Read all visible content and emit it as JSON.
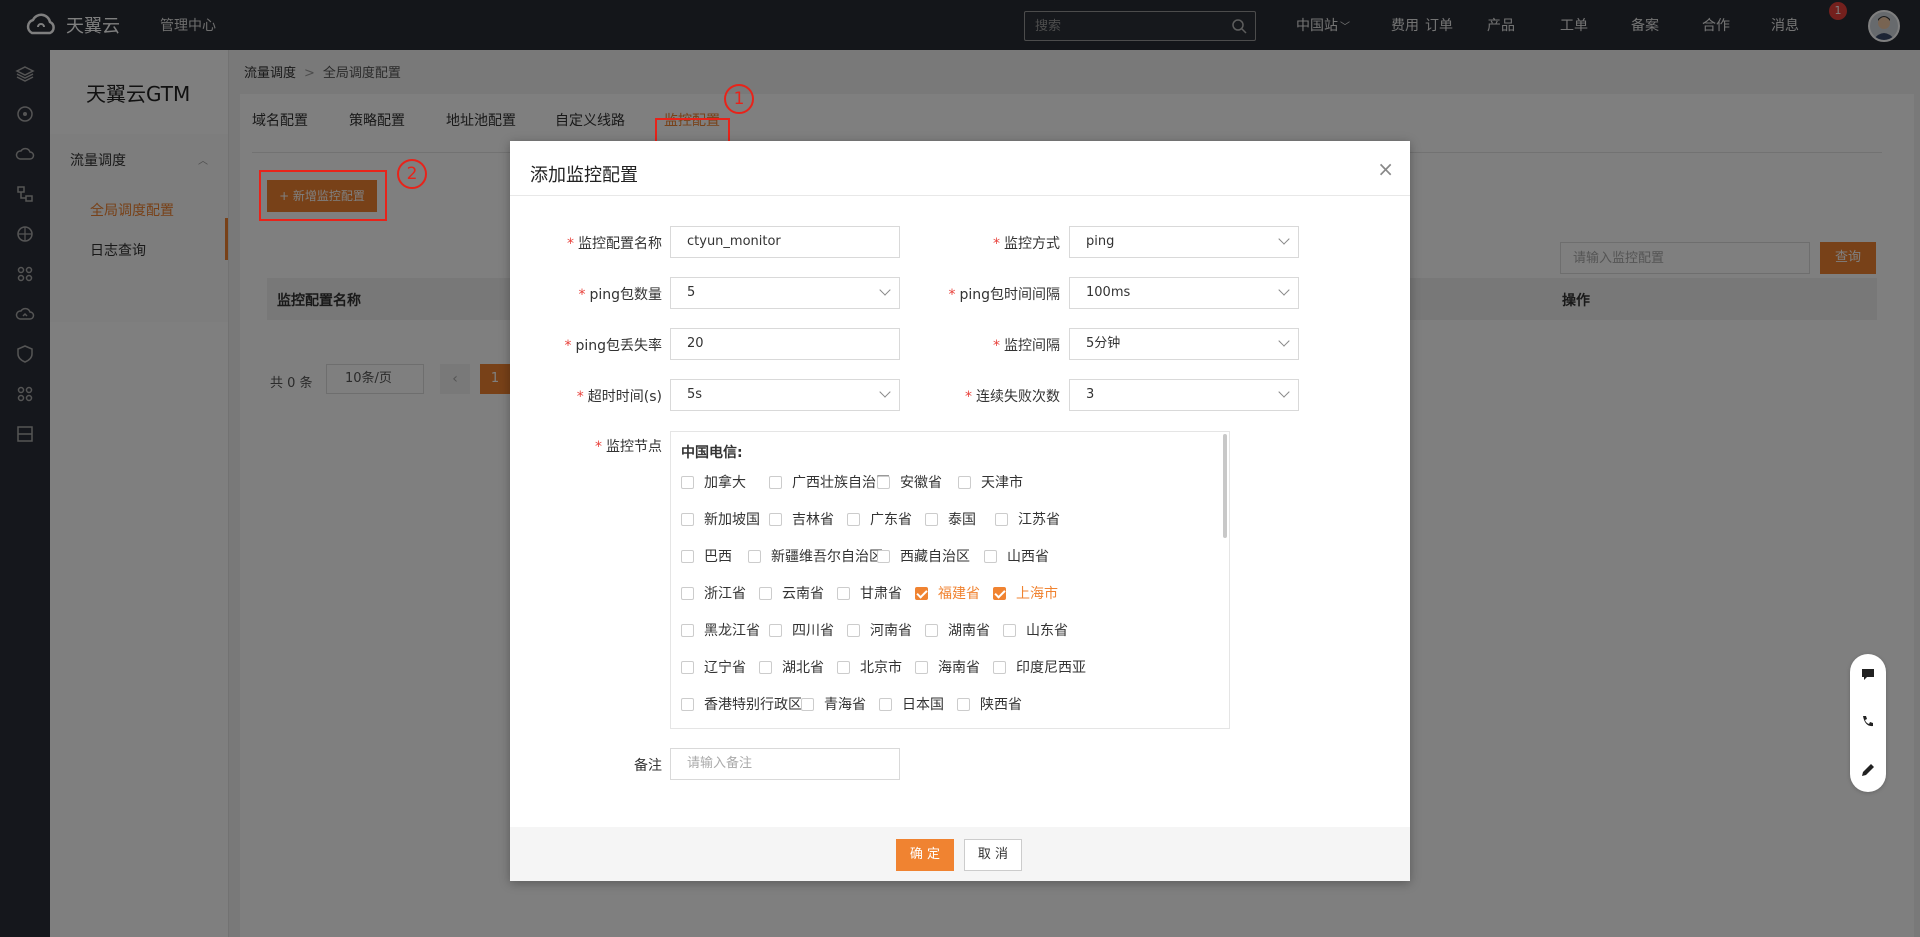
{
  "topbar": {
    "brand": "天翼云",
    "mgmt": "管理中心",
    "search_placeholder": "搜索",
    "nav": [
      "中国站",
      "费用",
      "订单",
      "产品",
      "工单",
      "备案",
      "合作",
      "消息"
    ],
    "msg_badge": "1"
  },
  "sidebar": {
    "title": "天翼云GTM",
    "group": "流量调度",
    "items": [
      "全局调度配置",
      "日志查询"
    ]
  },
  "breadcrumb": {
    "parent": "流量调度",
    "current": "全局调度配置"
  },
  "tabs": [
    "域名配置",
    "策略配置",
    "地址池配置",
    "自定义线路",
    "监控配置"
  ],
  "toolbar": {
    "add_label": "+ 新增监控配置",
    "query_placeholder": "请输入监控配置",
    "query_label": "查询"
  },
  "table": {
    "col_name": "监控配置名称",
    "col_op": "操作"
  },
  "pager": {
    "total": "共 0 条",
    "pagesize": "10条/页",
    "current": "1"
  },
  "annotations": {
    "one": "1",
    "two": "2"
  },
  "dialog": {
    "title": "添加监控配置",
    "close": "×",
    "fields": {
      "name_label": "监控配置名称",
      "name_value": "ctyun_monitor",
      "method_label": "监控方式",
      "method_value": "ping",
      "ping_count_label": "ping包数量",
      "ping_count_value": "5",
      "ping_interval_label": "ping包时间间隔",
      "ping_interval_value": "100ms",
      "loss_label": "ping包丢失率",
      "loss_value": "20",
      "monitor_interval_label": "监控间隔",
      "monitor_interval_value": "5分钟",
      "timeout_label": "超时时间(s)",
      "timeout_value": "5s",
      "fail_label": "连续失败次数",
      "fail_value": "3",
      "nodes_label": "监控节点",
      "remark_label": "备注",
      "remark_placeholder": "请输入备注"
    },
    "nodes_group": "中国电信:",
    "nodes": [
      [
        "加拿大",
        "广西壮族自治区",
        "安徽省",
        "天津市"
      ],
      [
        "新加坡国",
        "吉林省",
        "广东省",
        "泰国",
        "江苏省"
      ],
      [
        "巴西",
        "新疆维吾尔自治区",
        "西藏自治区",
        "山西省"
      ],
      [
        "浙江省",
        "云南省",
        "甘肃省",
        "福建省",
        "上海市"
      ],
      [
        "黑龙江省",
        "四川省",
        "河南省",
        "湖南省",
        "山东省"
      ],
      [
        "辽宁省",
        "湖北省",
        "北京市",
        "海南省",
        "印度尼西亚"
      ],
      [
        "香港特别行政区",
        "青海省",
        "日本国",
        "陕西省"
      ]
    ],
    "checked": [
      "福建省",
      "上海市"
    ],
    "ok": "确 定",
    "cancel": "取 消"
  },
  "colors": {
    "accent": "#f08331",
    "annotation": "#e8231a",
    "topbar": "#282c35"
  }
}
